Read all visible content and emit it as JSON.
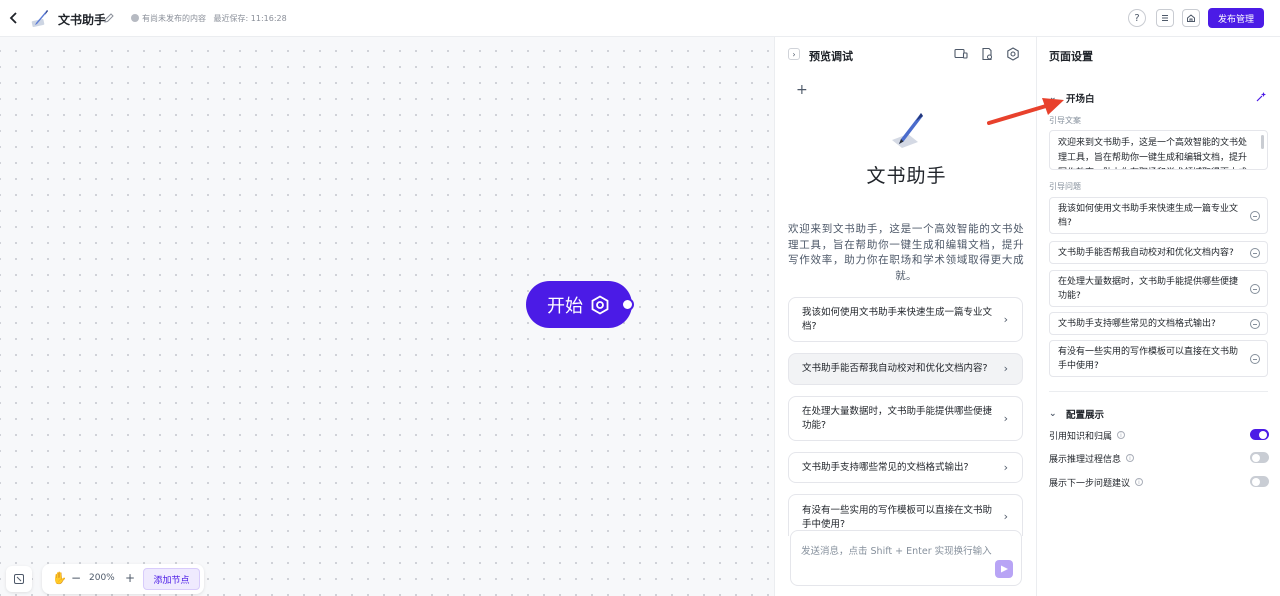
{
  "header": {
    "app_title": "文书助手",
    "status_text": "有尚未发布的内容",
    "last_saved": "最近保存: 11:16:28",
    "publish_label": "发布管理",
    "icons": [
      "help-icon",
      "list-icon",
      "home-icon"
    ]
  },
  "canvas": {
    "start_node_label": "开始",
    "zoom_level": "200%",
    "zoom_out": "−",
    "zoom_in": "+",
    "add_node_label": "添加节点"
  },
  "preview": {
    "title": "预览调试",
    "plus": "+",
    "bot_name": "文书助手",
    "welcome": "欢迎来到文书助手，这是一个高效智能的文书处理工具，旨在帮助你一键生成和编辑文档，提升写作效率，助力你在职场和学术领域取得更大成就。",
    "questions": [
      "我该如何使用文书助手来快速生成一篇专业文档?",
      "文书助手能否帮我自动校对和优化文档内容?",
      "在处理大量数据时，文书助手能提供哪些便捷功能?",
      "文书助手支持哪些常见的文档格式输出?",
      "有没有一些实用的写作模板可以直接在文书助手中使用?"
    ],
    "input_placeholder": "发送消息，点击 Shift + Enter 实现换行输入"
  },
  "settings": {
    "title": "页面设置",
    "opening_section": "开场白",
    "guide_text_label": "引导文案",
    "guide_text": "欢迎来到文书助手，这是一个高效智能的文书处理工具，旨在帮助你一键生成和编辑文档，提升写作效率，助力你在职场和学术领域取得更大成就。",
    "guide_questions_label": "引导问题",
    "guide_questions": [
      "我该如何使用文书助手来快速生成一篇专业文档?",
      "文书助手能否帮我自动校对和优化文档内容?",
      "在处理大量数据时，文书助手能提供哪些便捷功能?",
      "文书助手支持哪些常见的文档格式输出?",
      "有没有一些实用的写作模板可以直接在文书助手中使用?"
    ],
    "display_section": "配置展示",
    "toggles": [
      {
        "label": "引用知识和归属",
        "on": true
      },
      {
        "label": "展示推理过程信息",
        "on": false
      },
      {
        "label": "展示下一步问题建议",
        "on": false
      }
    ]
  },
  "colors": {
    "accent": "#4b1be6",
    "annotation_arrow": "#e8412c"
  }
}
